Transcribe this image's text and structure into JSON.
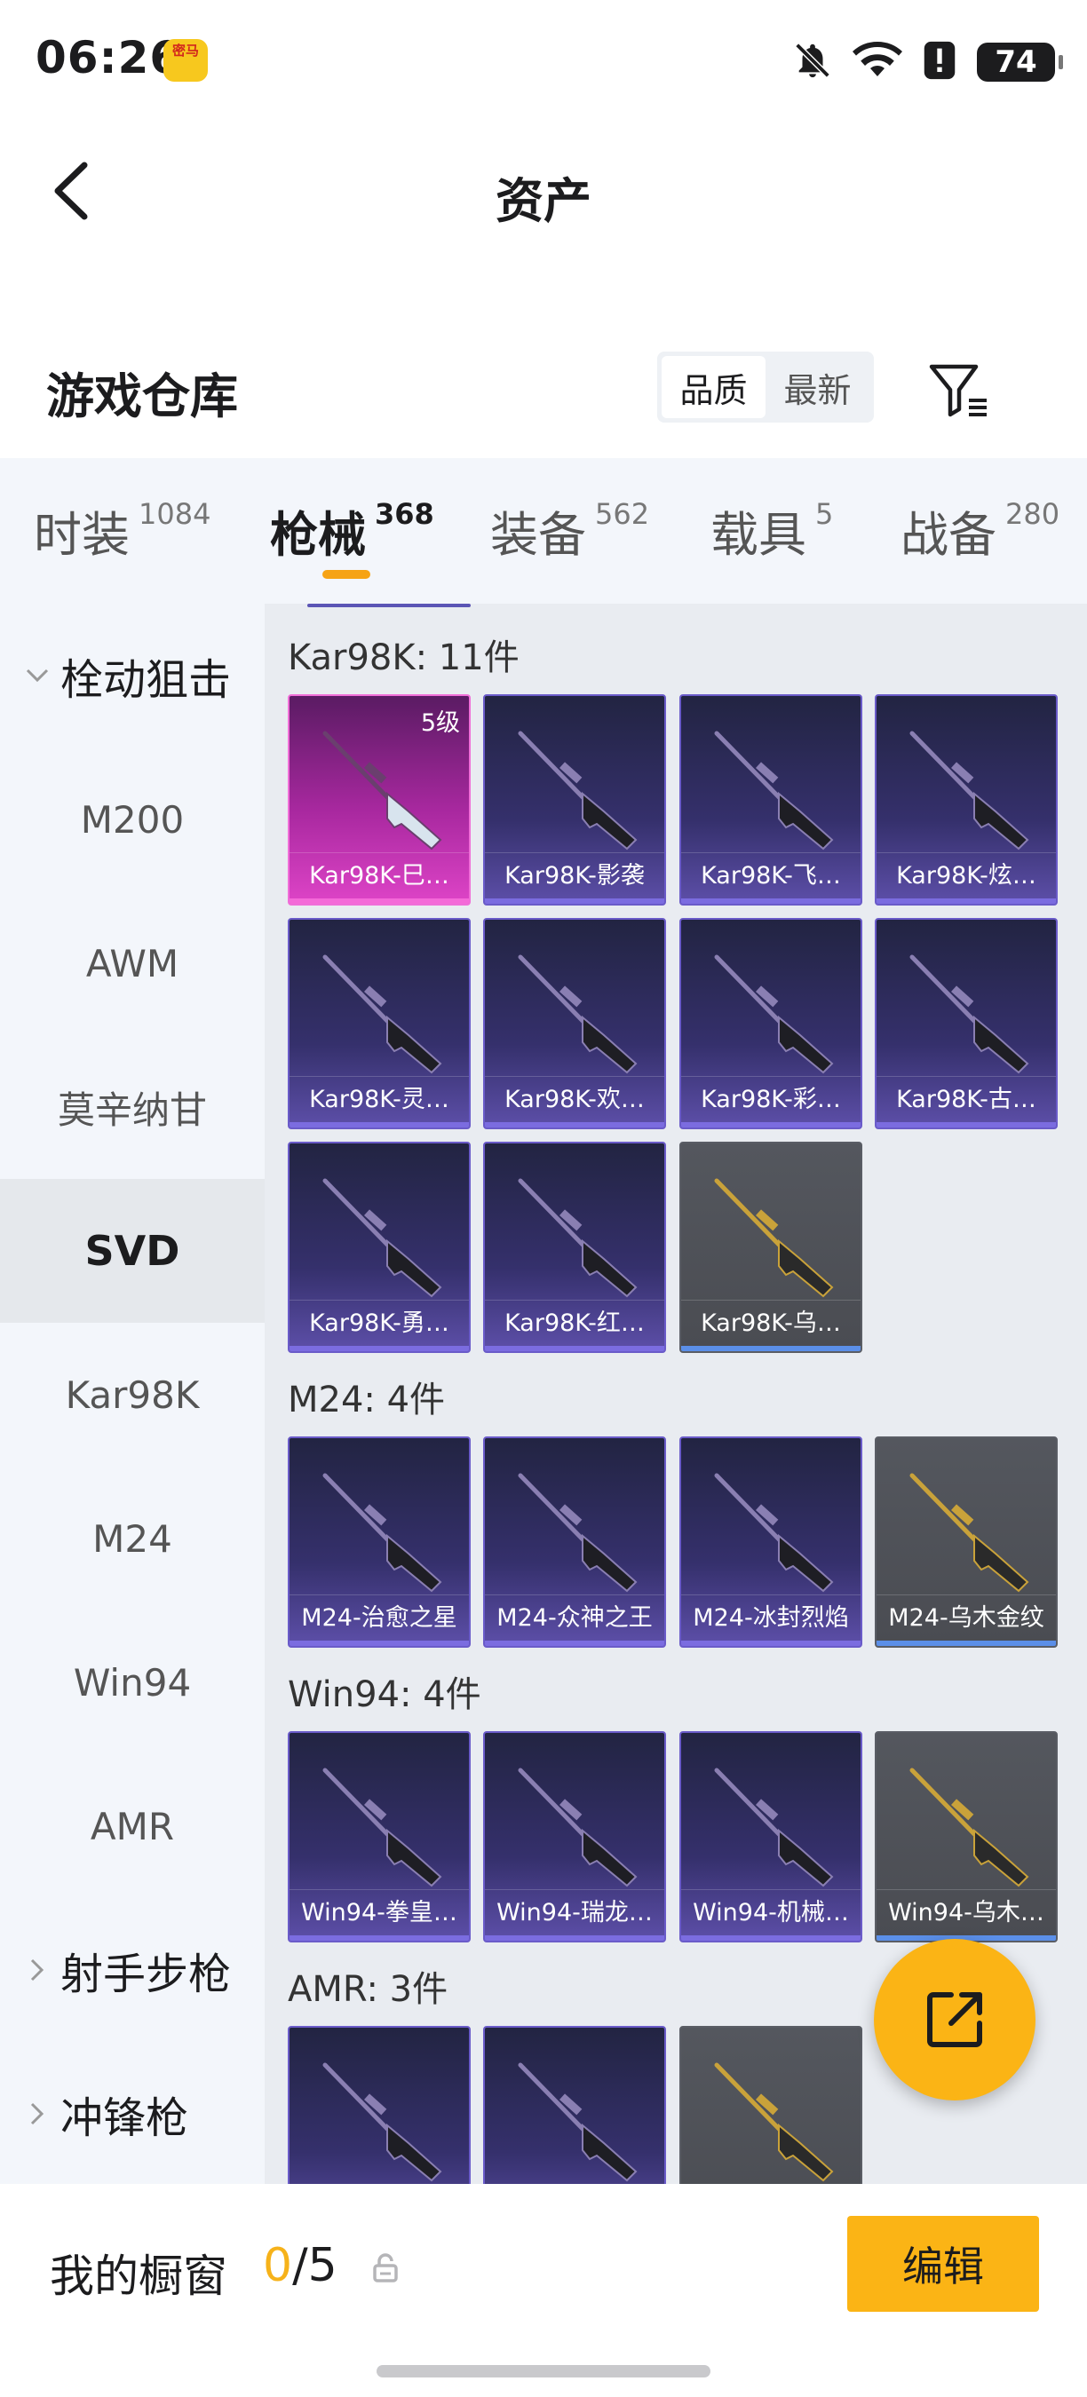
{
  "status_bar": {
    "time": "06:26",
    "app_badge": "密马",
    "battery": "74",
    "icons": [
      "bell-muted-icon",
      "wifi-icon",
      "alert-icon",
      "battery-icon"
    ]
  },
  "nav": {
    "title": "资产"
  },
  "warehouse": {
    "title": "游戏仓库",
    "sort_options": [
      "品质",
      "最新"
    ],
    "sort_selected": "品质"
  },
  "tabs": [
    {
      "label": "时装",
      "count": "1084"
    },
    {
      "label": "枪械",
      "count": "368"
    },
    {
      "label": "装备",
      "count": "562"
    },
    {
      "label": "载具",
      "count": "5"
    },
    {
      "label": "战备",
      "count": "280"
    }
  ],
  "active_tab": "枪械",
  "sidebar": {
    "group_open": "栓动狙击",
    "items": [
      "M200",
      "AWM",
      "莫辛纳甘",
      "SVD",
      "Kar98K",
      "M24",
      "Win94",
      "AMR"
    ],
    "active_item": "SVD",
    "group_2": "射手步枪",
    "group_3": "冲锋枪"
  },
  "sections": [
    {
      "title": "Kar98K: 11件",
      "items": [
        {
          "name": "Kar98K-巳…",
          "level": "5级",
          "rarity": "pink"
        },
        {
          "name": "Kar98K-影袭",
          "rarity": "purple"
        },
        {
          "name": "Kar98K-飞…",
          "rarity": "purple"
        },
        {
          "name": "Kar98K-炫…",
          "rarity": "purple"
        },
        {
          "name": "Kar98K-灵…",
          "rarity": "purple"
        },
        {
          "name": "Kar98K-欢…",
          "rarity": "purple"
        },
        {
          "name": "Kar98K-彩…",
          "rarity": "purple"
        },
        {
          "name": "Kar98K-古…",
          "rarity": "purple"
        },
        {
          "name": "Kar98K-勇…",
          "rarity": "purple"
        },
        {
          "name": "Kar98K-红…",
          "rarity": "purple"
        },
        {
          "name": "Kar98K-乌…",
          "rarity": "gray"
        }
      ]
    },
    {
      "title": "M24: 4件",
      "items": [
        {
          "name": "M24-治愈之星",
          "rarity": "purple"
        },
        {
          "name": "M24-众神之王",
          "rarity": "purple"
        },
        {
          "name": "M24-冰封烈焰",
          "rarity": "purple"
        },
        {
          "name": "M24-乌木金纹",
          "rarity": "gray"
        }
      ]
    },
    {
      "title": "Win94: 4件",
      "items": [
        {
          "name": "Win94-拳皇…",
          "rarity": "purple"
        },
        {
          "name": "Win94-瑞龙…",
          "rarity": "purple"
        },
        {
          "name": "Win94-机械…",
          "rarity": "purple"
        },
        {
          "name": "Win94-乌木…",
          "rarity": "gray"
        }
      ]
    },
    {
      "title": "AMR: 3件",
      "items": [
        {
          "name": "",
          "rarity": "purple"
        },
        {
          "name": "",
          "rarity": "purple"
        },
        {
          "name": "",
          "rarity": "gray"
        }
      ]
    }
  ],
  "bottom": {
    "showcase_label": "我的橱窗",
    "showcase_used": "0",
    "showcase_total": "/5",
    "edit_label": "编辑"
  },
  "colors": {
    "accent": "#fbb415",
    "rarity_purple": "#6a5bc9",
    "rarity_pink": "#de44c7",
    "rarity_gray": "#54575e"
  }
}
